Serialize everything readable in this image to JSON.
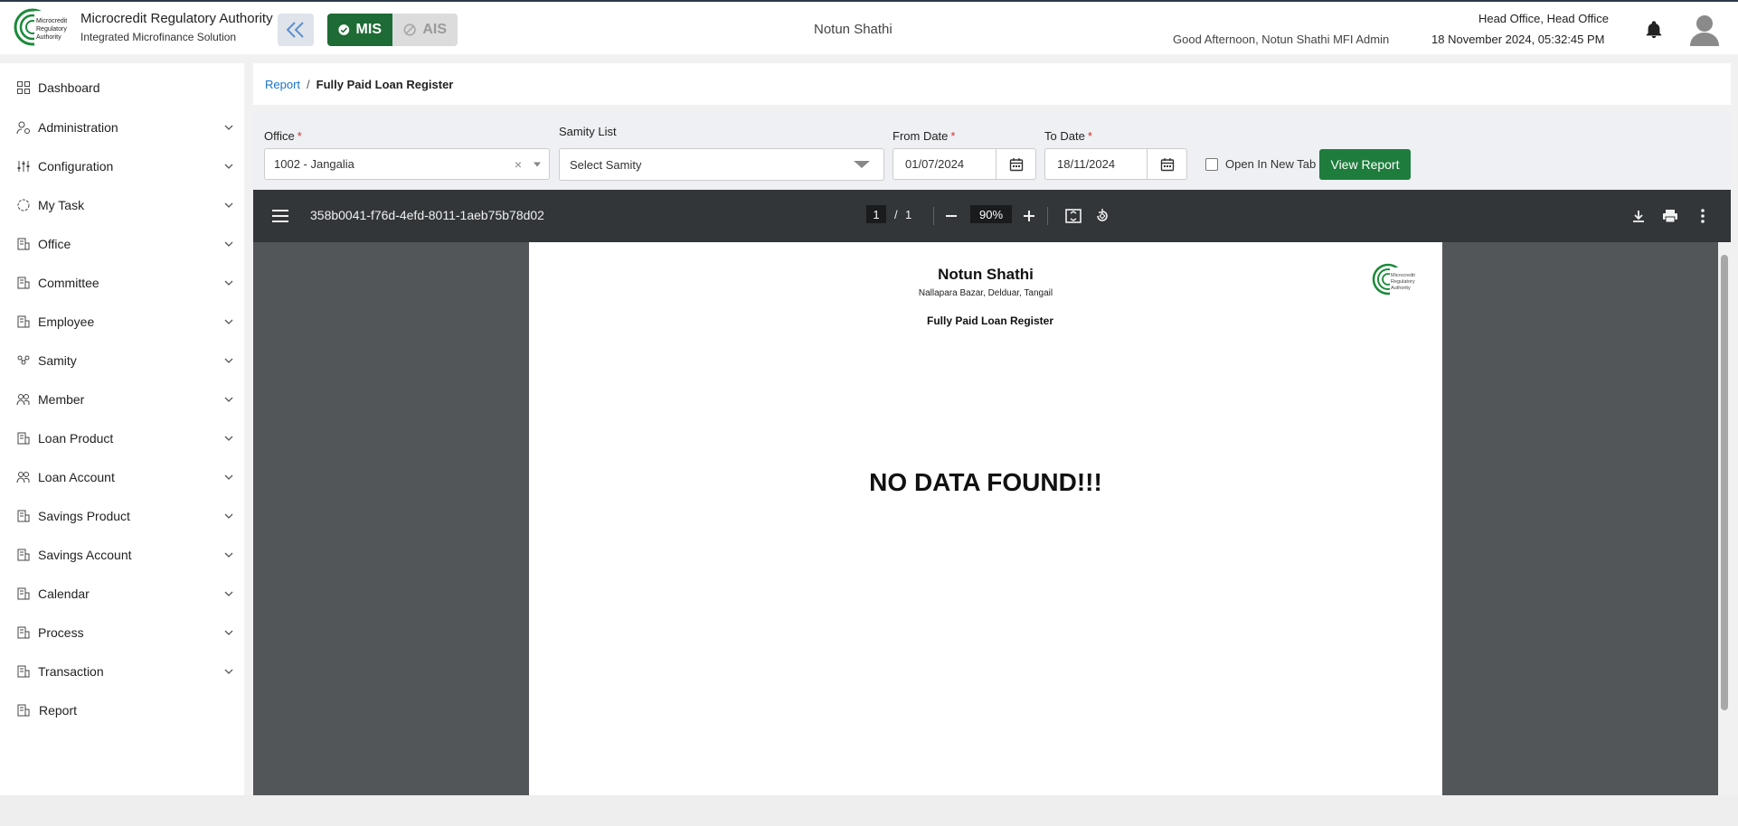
{
  "header": {
    "brand_title": "Microcredit Regulatory Authority",
    "brand_subtitle": "Integrated Microfinance Solution",
    "logo_text": "Microcredit Regulatory Authority",
    "modes": {
      "mis": "MIS",
      "ais": "AIS"
    },
    "app_center": "Notun Shathi",
    "greeting": "Good Afternoon, Notun Shathi MFI Admin",
    "office": "Head Office, Head Office",
    "datetime": "18 November 2024, 05:32:45 PM"
  },
  "sidebar": {
    "items": [
      {
        "label": "Dashboard",
        "icon": "dashboard-icon",
        "expandable": false
      },
      {
        "label": "Administration",
        "icon": "admin-icon",
        "expandable": true
      },
      {
        "label": "Configuration",
        "icon": "sliders-icon",
        "expandable": true
      },
      {
        "label": "My Task",
        "icon": "task-icon",
        "expandable": true
      },
      {
        "label": "Office",
        "icon": "building-icon",
        "expandable": true
      },
      {
        "label": "Committee",
        "icon": "building-icon",
        "expandable": true
      },
      {
        "label": "Employee",
        "icon": "building-icon",
        "expandable": true
      },
      {
        "label": "Samity",
        "icon": "group-icon",
        "expandable": true
      },
      {
        "label": "Member",
        "icon": "people-icon",
        "expandable": true
      },
      {
        "label": "Loan Product",
        "icon": "building-icon",
        "expandable": true
      },
      {
        "label": "Loan Account",
        "icon": "people-icon",
        "expandable": true
      },
      {
        "label": "Savings Product",
        "icon": "building-icon",
        "expandable": true
      },
      {
        "label": "Savings Account",
        "icon": "building-icon",
        "expandable": true
      },
      {
        "label": "Calendar",
        "icon": "building-icon",
        "expandable": true
      },
      {
        "label": "Process",
        "icon": "building-icon",
        "expandable": true
      },
      {
        "label": "Transaction",
        "icon": "building-icon",
        "expandable": true
      },
      {
        "label": "Report",
        "icon": "building-icon",
        "expandable": false
      }
    ]
  },
  "breadcrumb": {
    "parent": "Report",
    "separator": "/",
    "current": "Fully Paid Loan Register"
  },
  "filters": {
    "office_label": "Office",
    "office_value": "1002 - Jangalia",
    "samity_label": "Samity List",
    "samity_placeholder": "Select Samity",
    "from_label": "From Date",
    "from_value": "01/07/2024",
    "to_label": "To Date",
    "to_value": "18/11/2024",
    "required_mark": "*",
    "open_new_tab_label": "Open In New Tab",
    "open_new_tab_checked": false,
    "view_button": "View Report"
  },
  "pdf_viewer": {
    "file_name": "358b0041-f76d-4efd-8011-1aeb75b78d02",
    "page_current": "1",
    "page_sep": "/",
    "page_total": "1",
    "zoom": "90%"
  },
  "document": {
    "title": "Notun Shathi",
    "address": "Nallapara Bazar, Delduar, Tangail",
    "report_name": "Fully Paid Loan Register",
    "message": "NO DATA FOUND!!!"
  },
  "colors": {
    "accent_green": "#1e7d3d",
    "link_blue": "#1a73c8",
    "required_red": "#d32f2f",
    "viewer_dark": "#323639"
  }
}
